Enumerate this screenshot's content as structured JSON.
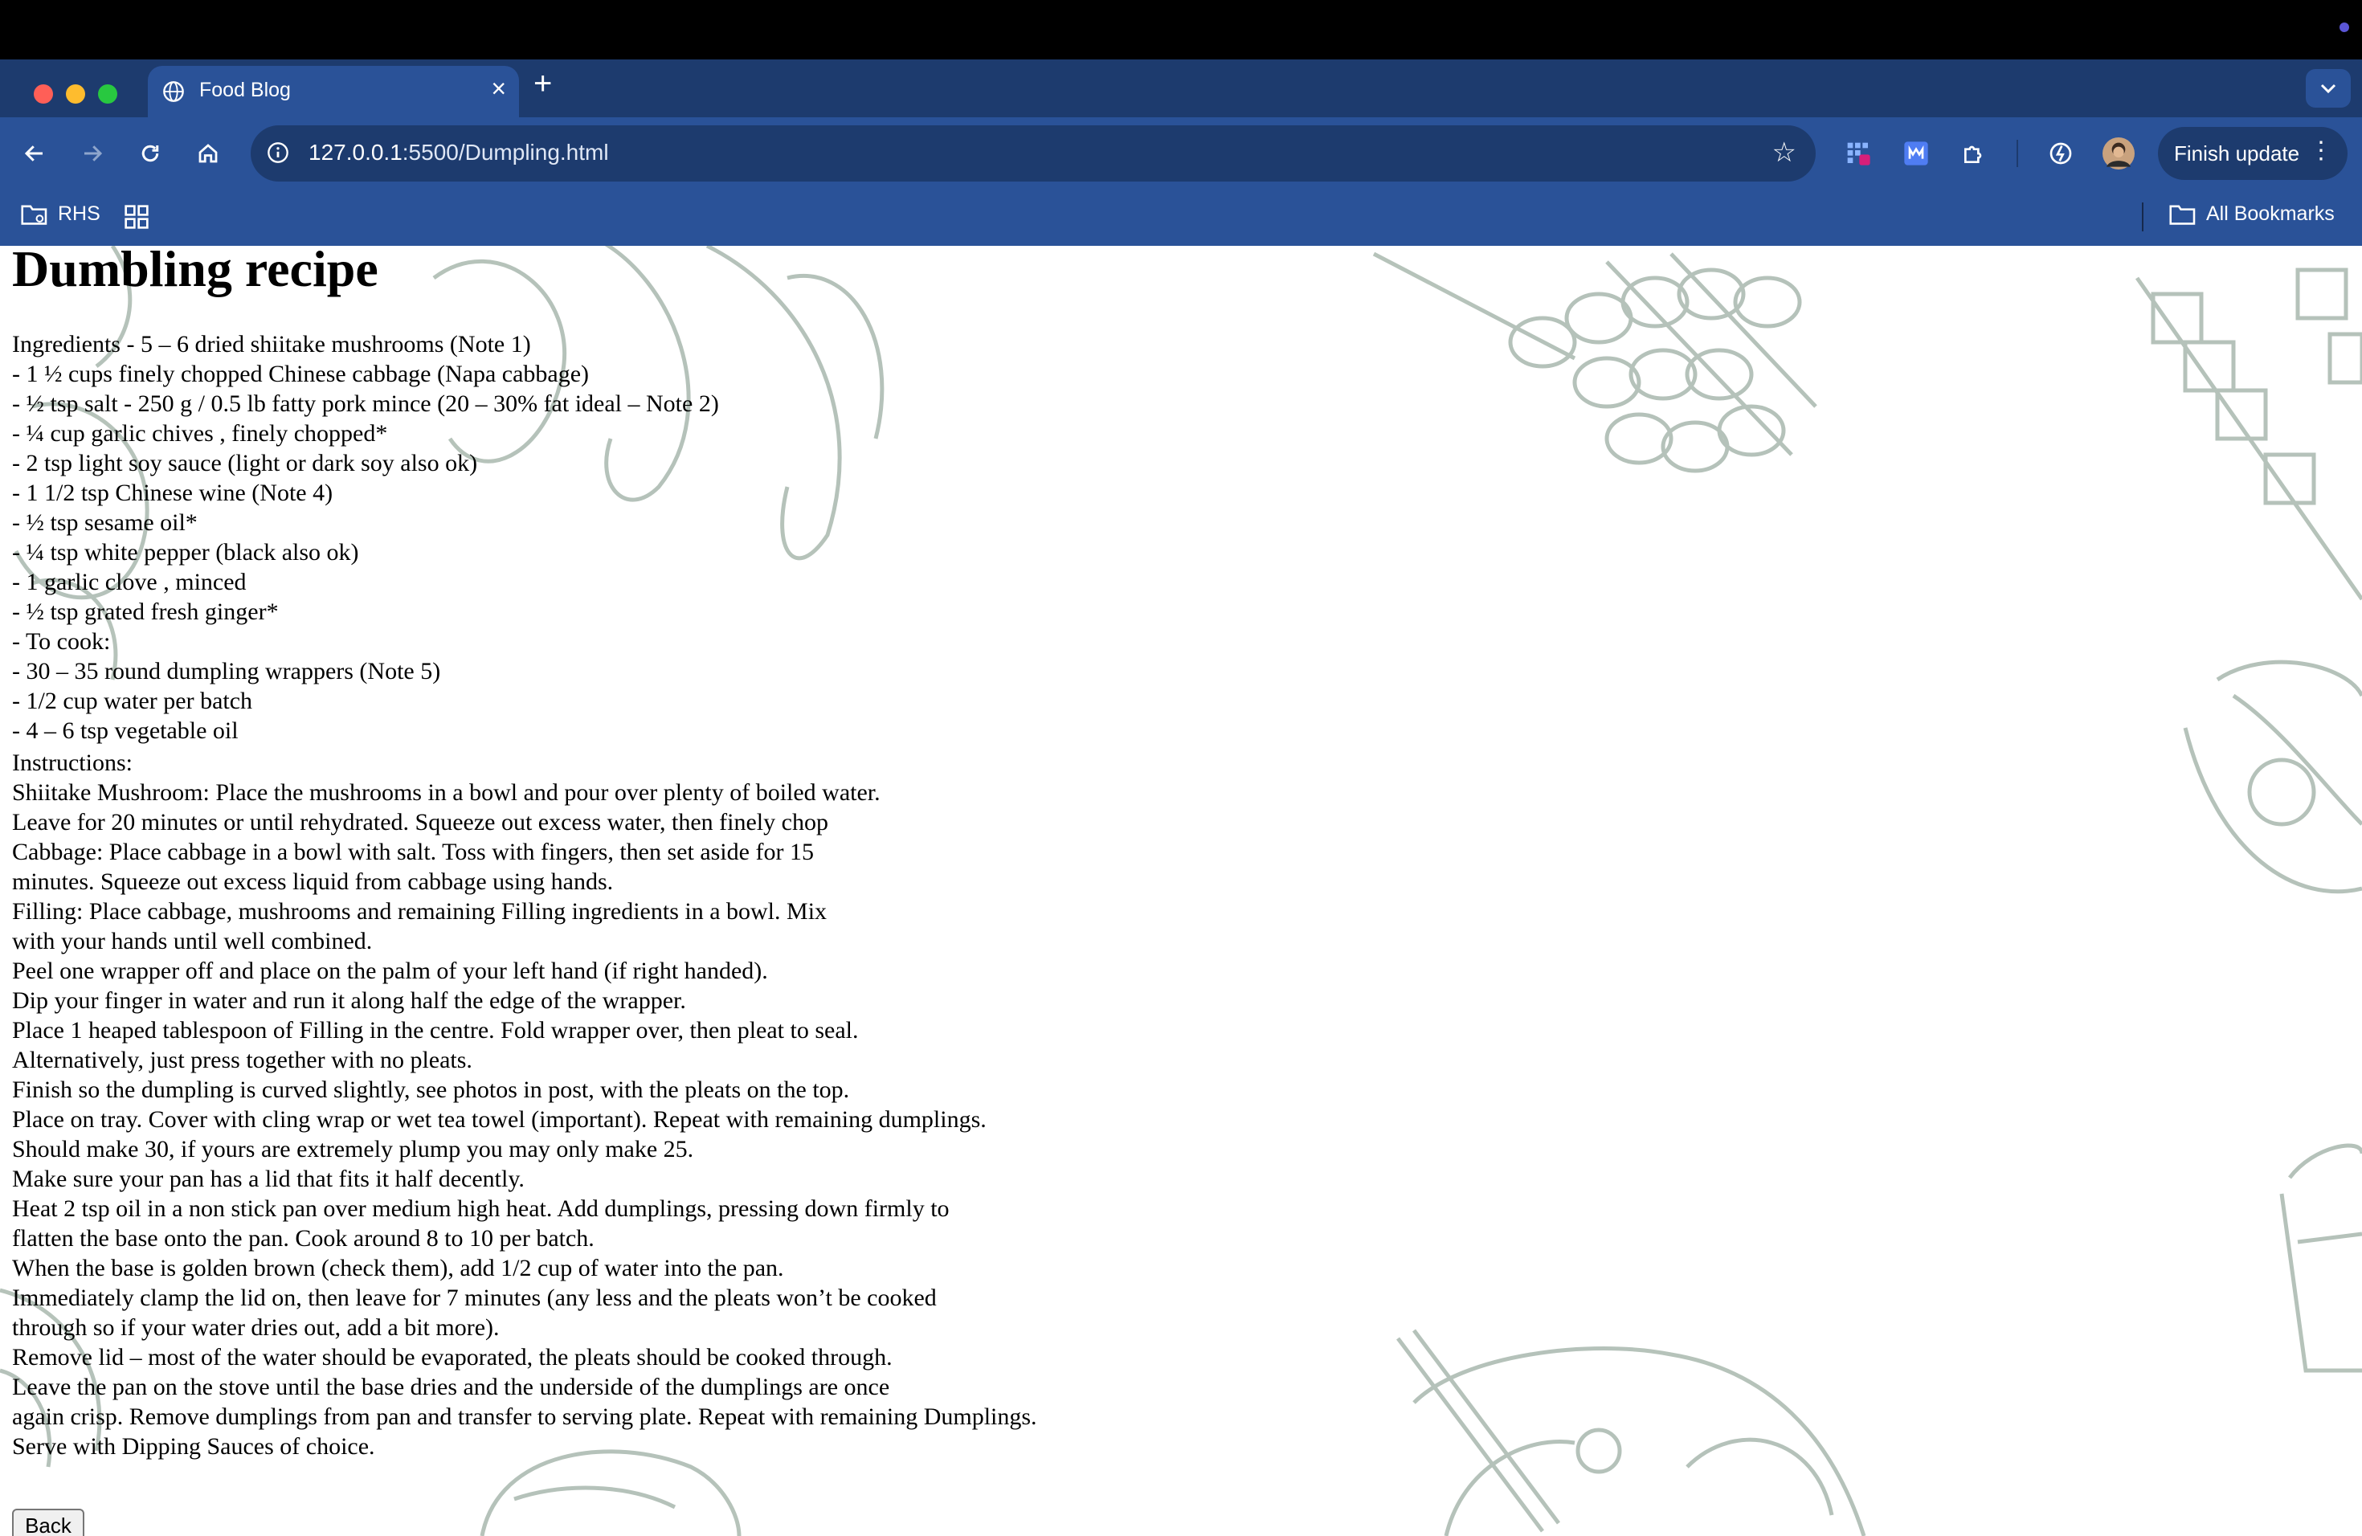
{
  "browser": {
    "tab": {
      "title": "Food Blog",
      "close_glyph": "×"
    },
    "new_tab_glyph": "+",
    "url": {
      "host": "127.0.0.1",
      "path": ":5500/Dumpling.html"
    },
    "finish_update_label": "Finish update",
    "bookmarks": {
      "rhs_label": "RHS",
      "all_label": "All Bookmarks"
    }
  },
  "page": {
    "title": "Dumbling recipe",
    "ingredients": [
      "Ingredients - 5 – 6 dried shiitake mushrooms (Note 1)",
      "- 1 ½ cups finely chopped Chinese cabbage (Napa cabbage)",
      "- ½ tsp salt - 250 g / 0.5 lb fatty pork mince (20 – 30% fat ideal – Note 2)",
      "- ¼ cup garlic chives , finely chopped*",
      "- 2 tsp light soy sauce (light or dark soy also ok)",
      "- 1 1/2 tsp Chinese wine (Note 4)",
      "- ½ tsp sesame oil*",
      "- ¼ tsp white pepper (black also ok)",
      "- 1 garlic clove , minced",
      "- ½ tsp grated fresh ginger*",
      "- To cook:",
      "- 30 – 35 round dumpling wrappers (Note 5)",
      "- 1/2 cup water per batch",
      "- 4 – 6 tsp vegetable oil"
    ],
    "instructions": [
      "Instructions:",
      "Shiitake Mushroom: Place the mushrooms in a bowl and pour over plenty of boiled water.",
      "Leave for 20 minutes or until rehydrated. Squeeze out excess water, then finely chop",
      "Cabbage: Place cabbage in a bowl with salt. Toss with fingers, then set aside for 15",
      "minutes. Squeeze out excess liquid from cabbage using hands.",
      "Filling: Place cabbage, mushrooms and remaining Filling ingredients in a bowl. Mix",
      "with your hands until well combined.",
      "Peel one wrapper off and place on the palm of your left hand (if right handed).",
      "Dip your finger in water and run it along half the edge of the wrapper.",
      "Place 1 heaped tablespoon of Filling in the centre. Fold wrapper over, then pleat to seal.",
      "Alternatively, just press together with no pleats.",
      "Finish so the dumpling is curved slightly, see photos in post, with the pleats on the top.",
      "Place on tray. Cover with cling wrap or wet tea towel (important). Repeat with remaining dumplings.",
      "Should make 30, if yours are extremely plump you may only make 25.",
      "Make sure your pan has a lid that fits it half decently.",
      "Heat 2 tsp oil in a non stick pan over medium high heat. Add dumplings, pressing down firmly to",
      "flatten the base onto the pan. Cook around 8 to 10 per batch.",
      "When the base is golden brown (check them), add 1/2 cup of water into the pan.",
      "Immediately clamp the lid on, then leave for 7 minutes (any less and the pleats won’t be cooked",
      "through so if your water dries out, add a bit more).",
      "Remove lid – most of the water should be evaporated, the pleats should be cooked through.",
      "Leave the pan on the stove until the base dries and the underside of the dumplings are once",
      "again crisp. Remove dumplings from pan and transfer to serving plate. Repeat with remaining Dumplings.",
      "Serve with Dipping Sauces of choice."
    ],
    "back_label": "Back"
  },
  "colors": {
    "tab_strip": "#1d3b6e",
    "toolbar": "#2a5298",
    "doodle": "#a9b8ae",
    "page_bg": "#ffffff"
  },
  "icons": [
    "globe-icon",
    "close-icon",
    "plus-icon",
    "chevron-down-icon",
    "back-arrow-icon",
    "forward-arrow-icon",
    "reload-icon",
    "home-icon",
    "info-icon",
    "star-icon",
    "extension-grid-icon",
    "extension-m-icon",
    "puzzle-icon",
    "speed-icon",
    "avatar",
    "kebab-icon",
    "folder-icon",
    "apps-grid-icon"
  ]
}
